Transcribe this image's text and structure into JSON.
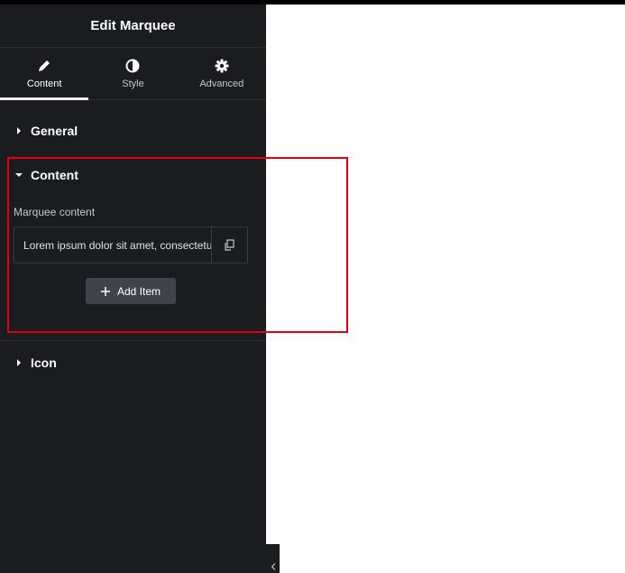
{
  "panel": {
    "title": "Edit Marquee",
    "tabs": [
      {
        "label": "Content",
        "icon": "pencil-icon",
        "active": true
      },
      {
        "label": "Style",
        "icon": "contrast-icon",
        "active": false
      },
      {
        "label": "Advanced",
        "icon": "gear-icon",
        "active": false
      }
    ]
  },
  "sections": {
    "general": {
      "label": "General",
      "expanded": false
    },
    "content": {
      "label": "Content",
      "expanded": true,
      "field_label": "Marquee content",
      "items": [
        {
          "title": "Lorem ipsum dolor sit amet, consectetu"
        }
      ],
      "add_button": "Add Item"
    },
    "icon": {
      "label": "Icon",
      "expanded": false
    }
  },
  "colors": {
    "panel_bg": "#1b1c1f",
    "highlight": "#e0000f",
    "button_bg": "#3f444b"
  }
}
